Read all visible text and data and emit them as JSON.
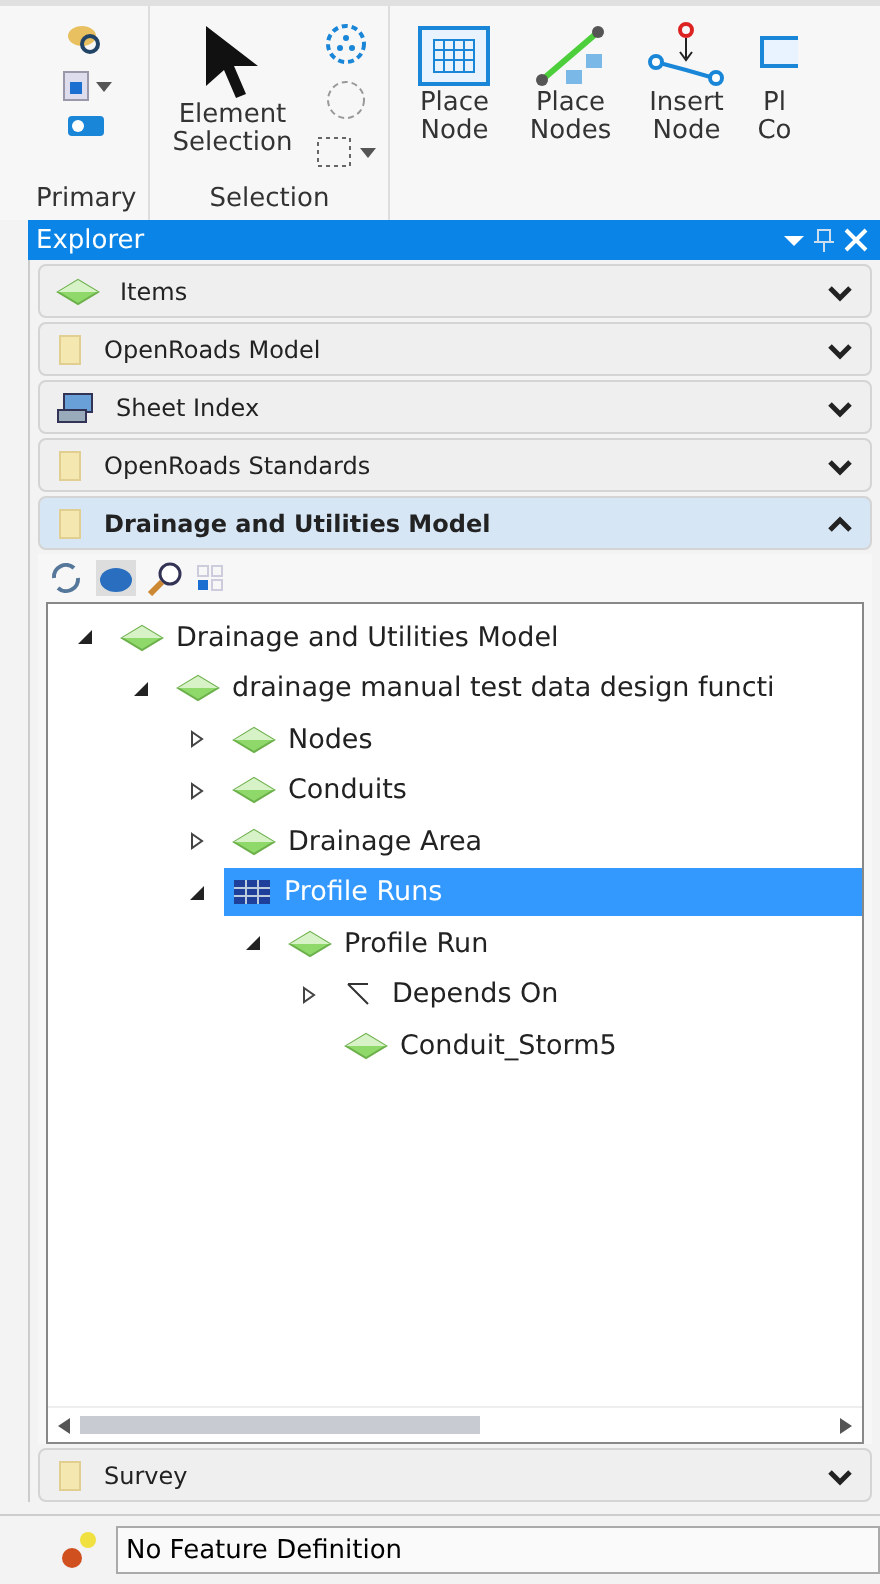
{
  "ribbon": {
    "groups": [
      {
        "label": "Primary",
        "kind": "primary"
      },
      {
        "label": "Selection",
        "kind": "selection",
        "button": "Element Selection"
      },
      {
        "kind": "tools",
        "buttons": [
          {
            "label": "Place Node",
            "kind": "grid"
          },
          {
            "label": "Place Nodes",
            "kind": "line"
          },
          {
            "label": "Insert Node",
            "kind": "insert"
          },
          {
            "label": "Pl Co",
            "kind": "pipe"
          }
        ]
      }
    ]
  },
  "explorer": {
    "title": "Explorer",
    "sections": [
      {
        "title": "Items",
        "kind": "gem",
        "expanded": false
      },
      {
        "title": "OpenRoads Model",
        "kind": "file",
        "expanded": false
      },
      {
        "title": "Sheet Index",
        "kind": "sheet",
        "expanded": false
      },
      {
        "title": "OpenRoads Standards",
        "kind": "file",
        "expanded": false
      },
      {
        "title": "Drainage and Utilities Model",
        "kind": "file",
        "expanded": true,
        "tree": [
          {
            "label": "Drainage and Utilities Model",
            "kind": "gem",
            "expanded": true,
            "selected": false,
            "children": [
              {
                "label": "drainage manual test data design functi",
                "kind": "gem",
                "expanded": true,
                "selected": false,
                "children": [
                  {
                    "label": "Nodes",
                    "kind": "gem",
                    "expanded": false,
                    "selected": false
                  },
                  {
                    "label": "Conduits",
                    "kind": "gem",
                    "expanded": false,
                    "selected": false
                  },
                  {
                    "label": "Drainage Area",
                    "kind": "gem",
                    "expanded": false,
                    "selected": false
                  },
                  {
                    "label": "Profile Runs",
                    "kind": "grid",
                    "expanded": true,
                    "selected": true,
                    "children": [
                      {
                        "label": "Profile Run",
                        "kind": "gem",
                        "expanded": true,
                        "selected": false,
                        "children": [
                          {
                            "label": "Depends On",
                            "kind": "depends",
                            "expanded": false,
                            "selected": false
                          },
                          {
                            "label": "Conduit_Storm5",
                            "kind": "gem",
                            "selected": false
                          }
                        ]
                      }
                    ]
                  }
                ]
              }
            ]
          }
        ]
      },
      {
        "title": "Survey",
        "kind": "file",
        "expanded": false
      }
    ]
  },
  "feature_bar": {
    "value": "No Feature Definition"
  }
}
